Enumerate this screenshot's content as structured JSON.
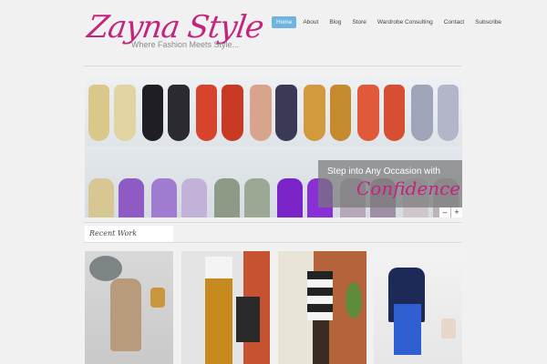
{
  "brand": {
    "title": "Zayna Style",
    "tagline": "Where Fashion Meets Style..."
  },
  "nav": {
    "items": [
      {
        "label": "Home",
        "active": true
      },
      {
        "label": "About"
      },
      {
        "label": "Blog"
      },
      {
        "label": "Store"
      },
      {
        "label": "Wardrobe Consulting"
      },
      {
        "label": "Contact"
      },
      {
        "label": "Subscribe"
      }
    ]
  },
  "slider": {
    "caption_line1": "Step into Any Occasion with",
    "caption_line2": "Confidence",
    "prev_label": "–",
    "next_label": "+"
  },
  "recent_work": {
    "title": "Recent Work"
  },
  "colors": {
    "brand": "#c2247e",
    "nav_active": "#6fb3e0",
    "background": "#f1f1f1"
  }
}
